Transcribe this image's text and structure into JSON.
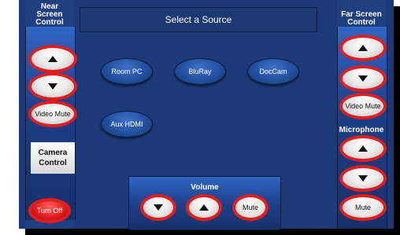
{
  "header": {
    "title": "Select a Source"
  },
  "near_screen": {
    "title_line1": "Near",
    "title_line2": "Screen",
    "title_line3": "Control",
    "video_mute_label": "Video Mute",
    "camera_line1": "Camera",
    "camera_line2": "Control",
    "turn_off_label": "Turn Off"
  },
  "far_screen": {
    "title_line1": "Far Screen",
    "title_line2": "Control",
    "video_mute_label": "Video Mute",
    "microphone_title": "Microphone",
    "mute_label": "Mute"
  },
  "sources": [
    {
      "label": "Room PC"
    },
    {
      "label": "BluRay"
    },
    {
      "label": "DocCam"
    },
    {
      "label": "Aux HDMI"
    }
  ],
  "volume": {
    "title": "Volume",
    "mute_label": "Mute"
  },
  "colors": {
    "panel": "#1c3a78",
    "accent_ring": "#e21d1d",
    "source_button": "#22509f"
  },
  "icons": {
    "up": "triangle-up",
    "down": "triangle-down"
  }
}
